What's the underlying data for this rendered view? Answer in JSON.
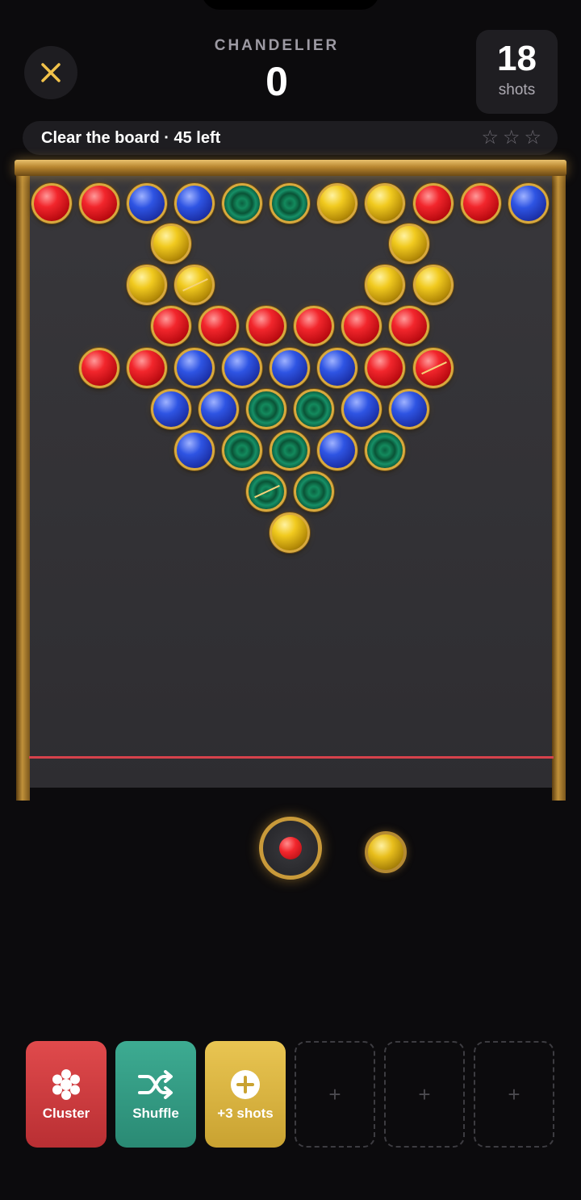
{
  "header": {
    "level_name": "CHANDELIER",
    "score": "0",
    "shots_count": "18",
    "shots_label": "shots"
  },
  "goal": {
    "text": "Clear the board · 45 left",
    "stars": [
      "☆",
      "☆",
      "☆"
    ]
  },
  "board": {
    "rows": [
      [
        "red",
        "red",
        "blue",
        "blue",
        "green",
        "green",
        "yellow",
        "yellow",
        "red",
        "red",
        "blue"
      ],
      [
        "yellow",
        "yellow"
      ],
      [
        "yellow",
        "yellow",
        "yellow",
        "yellow"
      ],
      [
        "red",
        "red",
        "red",
        "red",
        "red",
        "red"
      ],
      [
        "red",
        "red",
        "blue",
        "blue",
        "blue",
        "blue",
        "red",
        "red"
      ],
      [
        "blue",
        "blue",
        "green",
        "green",
        "blue",
        "blue"
      ],
      [
        "blue",
        "green",
        "green",
        "blue",
        "green"
      ],
      [
        "green",
        "green"
      ],
      [
        "yellow"
      ]
    ]
  },
  "shooter": {
    "current_color": "red",
    "next_color": "yellow"
  },
  "powerups": [
    {
      "label": "Cluster",
      "icon": "cluster-icon"
    },
    {
      "label": "Shuffle",
      "icon": "shuffle-icon"
    },
    {
      "label": "+3 shots",
      "icon": "plus-circle-icon"
    },
    {
      "label": "+",
      "icon": "empty-slot"
    },
    {
      "label": "+",
      "icon": "empty-slot"
    },
    {
      "label": "+",
      "icon": "empty-slot"
    }
  ],
  "colors": {
    "red": "#f2262c",
    "blue": "#2e54e3",
    "green": "#138a5d",
    "yellow": "#f1ca1f",
    "gold_rim": "#d8a93e",
    "danger_line": "#d6424b"
  }
}
